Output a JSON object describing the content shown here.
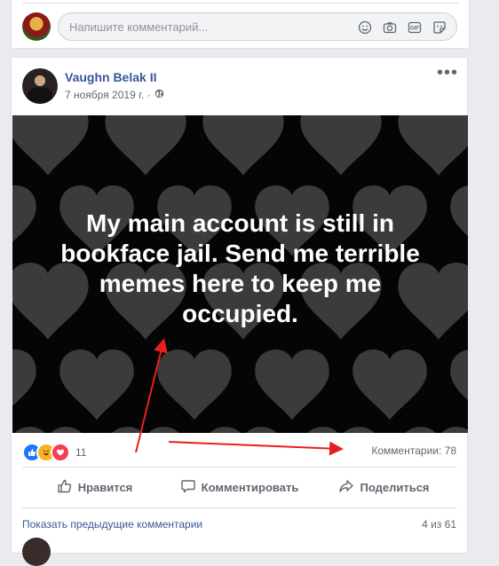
{
  "composer": {
    "placeholder": "Напишите комментарий...",
    "icons": [
      "smile-icon",
      "camera-icon",
      "gif-icon",
      "sticker-icon"
    ]
  },
  "post": {
    "author": "Vaughn Belak II",
    "date": "7 ноября 2019 г. ·",
    "privacy_icon": "globe-icon",
    "more_label": "•••",
    "image_text": "My main account is still in bookface jail. Send me terrible memes here to keep me occupied.",
    "image_background": "#050505",
    "heart_color": "#3b3b3b",
    "reactions": {
      "types": [
        "like",
        "haha",
        "love"
      ],
      "count": "11"
    },
    "comments_count": "Комментарии: 78",
    "actions": {
      "like": "Нравится",
      "comment": "Комментировать",
      "share": "Поделиться"
    },
    "show_previous": "Показать предыдущие комментарии",
    "comments_shown": "4 из 61"
  },
  "colors": {
    "link": "#385898",
    "muted": "#606770",
    "annotation_arrow": "#e5201f"
  }
}
